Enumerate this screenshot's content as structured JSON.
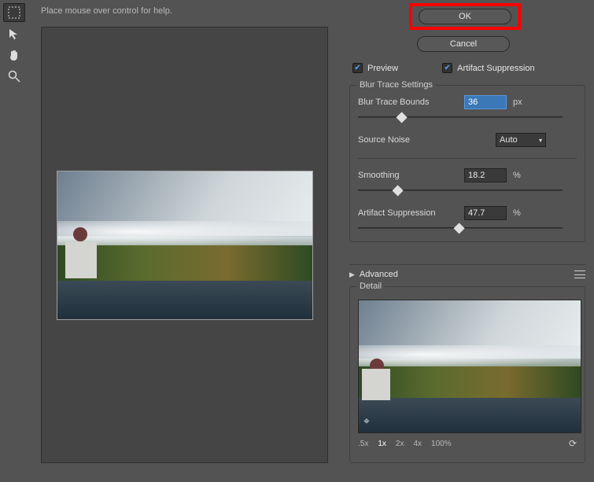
{
  "help_tip": "Place mouse over control for help.",
  "buttons": {
    "ok": "OK",
    "cancel": "Cancel"
  },
  "checkboxes": {
    "preview": {
      "label": "Preview",
      "checked": true
    },
    "artifact_suppression": {
      "label": "Artifact Suppression",
      "checked": true
    }
  },
  "blur_trace": {
    "legend": "Blur Trace Settings",
    "bounds": {
      "label": "Blur Trace Bounds",
      "value": "36",
      "unit": "px",
      "pos": 0.2
    },
    "noise": {
      "label": "Source Noise",
      "value": "Auto"
    },
    "smoothing": {
      "label": "Smoothing",
      "value": "18.2",
      "unit": "%",
      "pos": 0.18
    },
    "artifact": {
      "label": "Artifact Suppression",
      "value": "47.7",
      "unit": "%",
      "pos": 0.48
    }
  },
  "advanced": {
    "label": "Advanced"
  },
  "detail": {
    "legend": "Detail",
    "zoom": {
      "levels": [
        ".5x",
        "1x",
        "2x",
        "4x"
      ],
      "current": "100%",
      "active": "1x"
    }
  },
  "tools": {
    "marquee": "rectangular-marquee-tool",
    "arrow": "direct-select-tool",
    "hand": "hand-tool",
    "zoom": "zoom-tool"
  }
}
